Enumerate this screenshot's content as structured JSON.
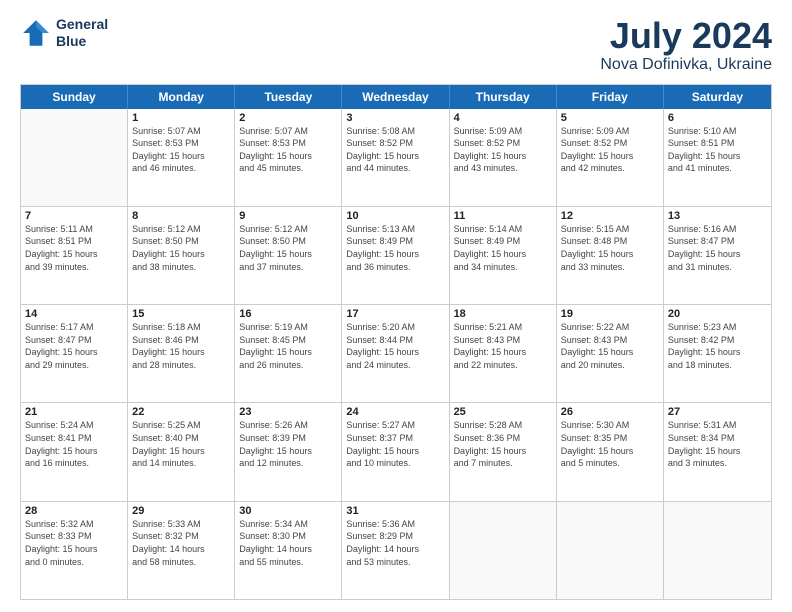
{
  "header": {
    "logo_line1": "General",
    "logo_line2": "Blue",
    "main_title": "July 2024",
    "subtitle": "Nova Dofinivka, Ukraine"
  },
  "calendar": {
    "days_of_week": [
      "Sunday",
      "Monday",
      "Tuesday",
      "Wednesday",
      "Thursday",
      "Friday",
      "Saturday"
    ],
    "rows": [
      [
        {
          "day": "",
          "info": ""
        },
        {
          "day": "1",
          "info": "Sunrise: 5:07 AM\nSunset: 8:53 PM\nDaylight: 15 hours\nand 46 minutes."
        },
        {
          "day": "2",
          "info": "Sunrise: 5:07 AM\nSunset: 8:53 PM\nDaylight: 15 hours\nand 45 minutes."
        },
        {
          "day": "3",
          "info": "Sunrise: 5:08 AM\nSunset: 8:52 PM\nDaylight: 15 hours\nand 44 minutes."
        },
        {
          "day": "4",
          "info": "Sunrise: 5:09 AM\nSunset: 8:52 PM\nDaylight: 15 hours\nand 43 minutes."
        },
        {
          "day": "5",
          "info": "Sunrise: 5:09 AM\nSunset: 8:52 PM\nDaylight: 15 hours\nand 42 minutes."
        },
        {
          "day": "6",
          "info": "Sunrise: 5:10 AM\nSunset: 8:51 PM\nDaylight: 15 hours\nand 41 minutes."
        }
      ],
      [
        {
          "day": "7",
          "info": "Sunrise: 5:11 AM\nSunset: 8:51 PM\nDaylight: 15 hours\nand 39 minutes."
        },
        {
          "day": "8",
          "info": "Sunrise: 5:12 AM\nSunset: 8:50 PM\nDaylight: 15 hours\nand 38 minutes."
        },
        {
          "day": "9",
          "info": "Sunrise: 5:12 AM\nSunset: 8:50 PM\nDaylight: 15 hours\nand 37 minutes."
        },
        {
          "day": "10",
          "info": "Sunrise: 5:13 AM\nSunset: 8:49 PM\nDaylight: 15 hours\nand 36 minutes."
        },
        {
          "day": "11",
          "info": "Sunrise: 5:14 AM\nSunset: 8:49 PM\nDaylight: 15 hours\nand 34 minutes."
        },
        {
          "day": "12",
          "info": "Sunrise: 5:15 AM\nSunset: 8:48 PM\nDaylight: 15 hours\nand 33 minutes."
        },
        {
          "day": "13",
          "info": "Sunrise: 5:16 AM\nSunset: 8:47 PM\nDaylight: 15 hours\nand 31 minutes."
        }
      ],
      [
        {
          "day": "14",
          "info": "Sunrise: 5:17 AM\nSunset: 8:47 PM\nDaylight: 15 hours\nand 29 minutes."
        },
        {
          "day": "15",
          "info": "Sunrise: 5:18 AM\nSunset: 8:46 PM\nDaylight: 15 hours\nand 28 minutes."
        },
        {
          "day": "16",
          "info": "Sunrise: 5:19 AM\nSunset: 8:45 PM\nDaylight: 15 hours\nand 26 minutes."
        },
        {
          "day": "17",
          "info": "Sunrise: 5:20 AM\nSunset: 8:44 PM\nDaylight: 15 hours\nand 24 minutes."
        },
        {
          "day": "18",
          "info": "Sunrise: 5:21 AM\nSunset: 8:43 PM\nDaylight: 15 hours\nand 22 minutes."
        },
        {
          "day": "19",
          "info": "Sunrise: 5:22 AM\nSunset: 8:43 PM\nDaylight: 15 hours\nand 20 minutes."
        },
        {
          "day": "20",
          "info": "Sunrise: 5:23 AM\nSunset: 8:42 PM\nDaylight: 15 hours\nand 18 minutes."
        }
      ],
      [
        {
          "day": "21",
          "info": "Sunrise: 5:24 AM\nSunset: 8:41 PM\nDaylight: 15 hours\nand 16 minutes."
        },
        {
          "day": "22",
          "info": "Sunrise: 5:25 AM\nSunset: 8:40 PM\nDaylight: 15 hours\nand 14 minutes."
        },
        {
          "day": "23",
          "info": "Sunrise: 5:26 AM\nSunset: 8:39 PM\nDaylight: 15 hours\nand 12 minutes."
        },
        {
          "day": "24",
          "info": "Sunrise: 5:27 AM\nSunset: 8:37 PM\nDaylight: 15 hours\nand 10 minutes."
        },
        {
          "day": "25",
          "info": "Sunrise: 5:28 AM\nSunset: 8:36 PM\nDaylight: 15 hours\nand 7 minutes."
        },
        {
          "day": "26",
          "info": "Sunrise: 5:30 AM\nSunset: 8:35 PM\nDaylight: 15 hours\nand 5 minutes."
        },
        {
          "day": "27",
          "info": "Sunrise: 5:31 AM\nSunset: 8:34 PM\nDaylight: 15 hours\nand 3 minutes."
        }
      ],
      [
        {
          "day": "28",
          "info": "Sunrise: 5:32 AM\nSunset: 8:33 PM\nDaylight: 15 hours\nand 0 minutes."
        },
        {
          "day": "29",
          "info": "Sunrise: 5:33 AM\nSunset: 8:32 PM\nDaylight: 14 hours\nand 58 minutes."
        },
        {
          "day": "30",
          "info": "Sunrise: 5:34 AM\nSunset: 8:30 PM\nDaylight: 14 hours\nand 55 minutes."
        },
        {
          "day": "31",
          "info": "Sunrise: 5:36 AM\nSunset: 8:29 PM\nDaylight: 14 hours\nand 53 minutes."
        },
        {
          "day": "",
          "info": ""
        },
        {
          "day": "",
          "info": ""
        },
        {
          "day": "",
          "info": ""
        }
      ]
    ]
  }
}
